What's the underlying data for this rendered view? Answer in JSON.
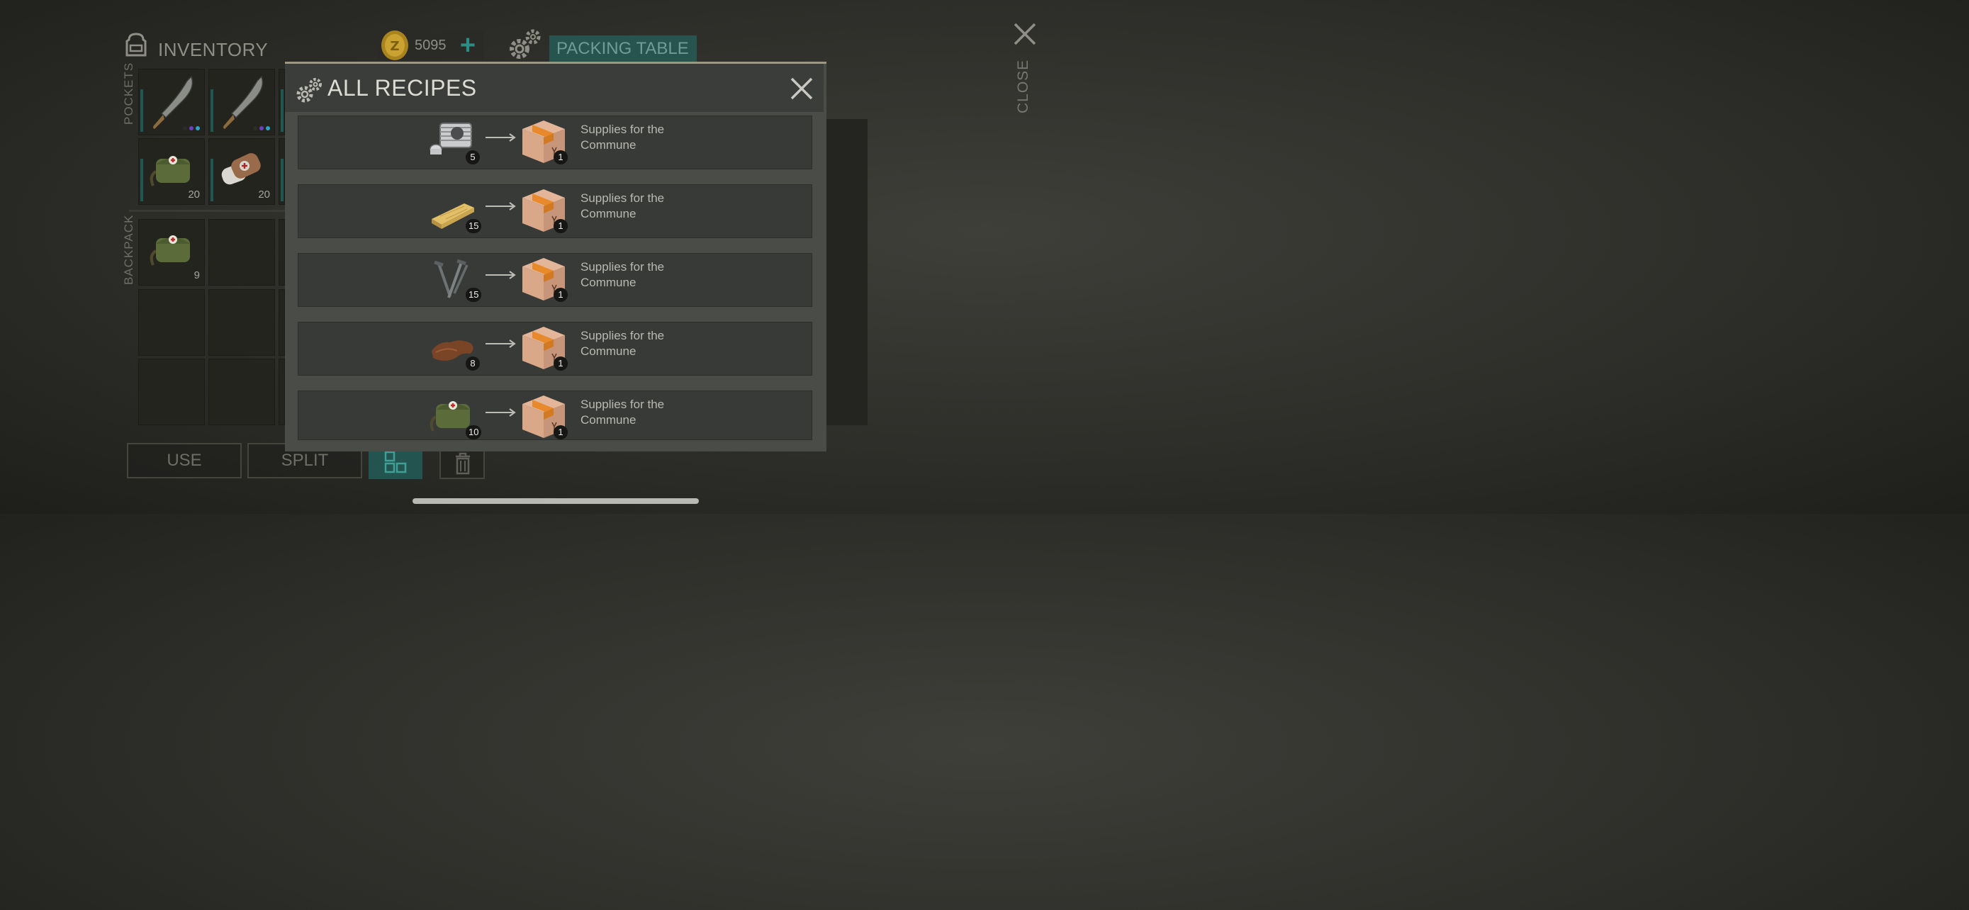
{
  "header": {
    "inventory_title": "INVENTORY",
    "coins": "5095",
    "plus": "+",
    "packing_table": "PACKING TABLE",
    "close": "CLOSE"
  },
  "labels": {
    "pockets": "POCKETS",
    "backpack": "BACKPACK"
  },
  "slots": {
    "pocket_medkit_count": "20",
    "pocket_bandage_count": "20",
    "backpack_medkit_count": "9"
  },
  "buttons": {
    "use": "USE",
    "split": "SPLIT"
  },
  "modal": {
    "title": "ALL RECIPES",
    "recipes": [
      {
        "input_icon": "engine-cylinder-icon",
        "input_count": "5",
        "output_count": "1",
        "name": "Supplies for the Commune"
      },
      {
        "input_icon": "wood-plank-icon",
        "input_count": "15",
        "output_count": "1",
        "name": "Supplies for the Commune"
      },
      {
        "input_icon": "nails-icon",
        "input_count": "15",
        "output_count": "1",
        "name": "Supplies for the Commune"
      },
      {
        "input_icon": "leather-icon",
        "input_count": "8",
        "output_count": "1",
        "name": "Supplies for the Commune"
      },
      {
        "input_icon": "medkit-bag-icon",
        "input_count": "10",
        "output_count": "1",
        "name": "Supplies for the Commune"
      }
    ]
  },
  "colors": {
    "accent": "#2b8d84",
    "packing_bg": "#27544f",
    "modal_bg": "#4a4c48",
    "row_bg": "#383a37"
  }
}
